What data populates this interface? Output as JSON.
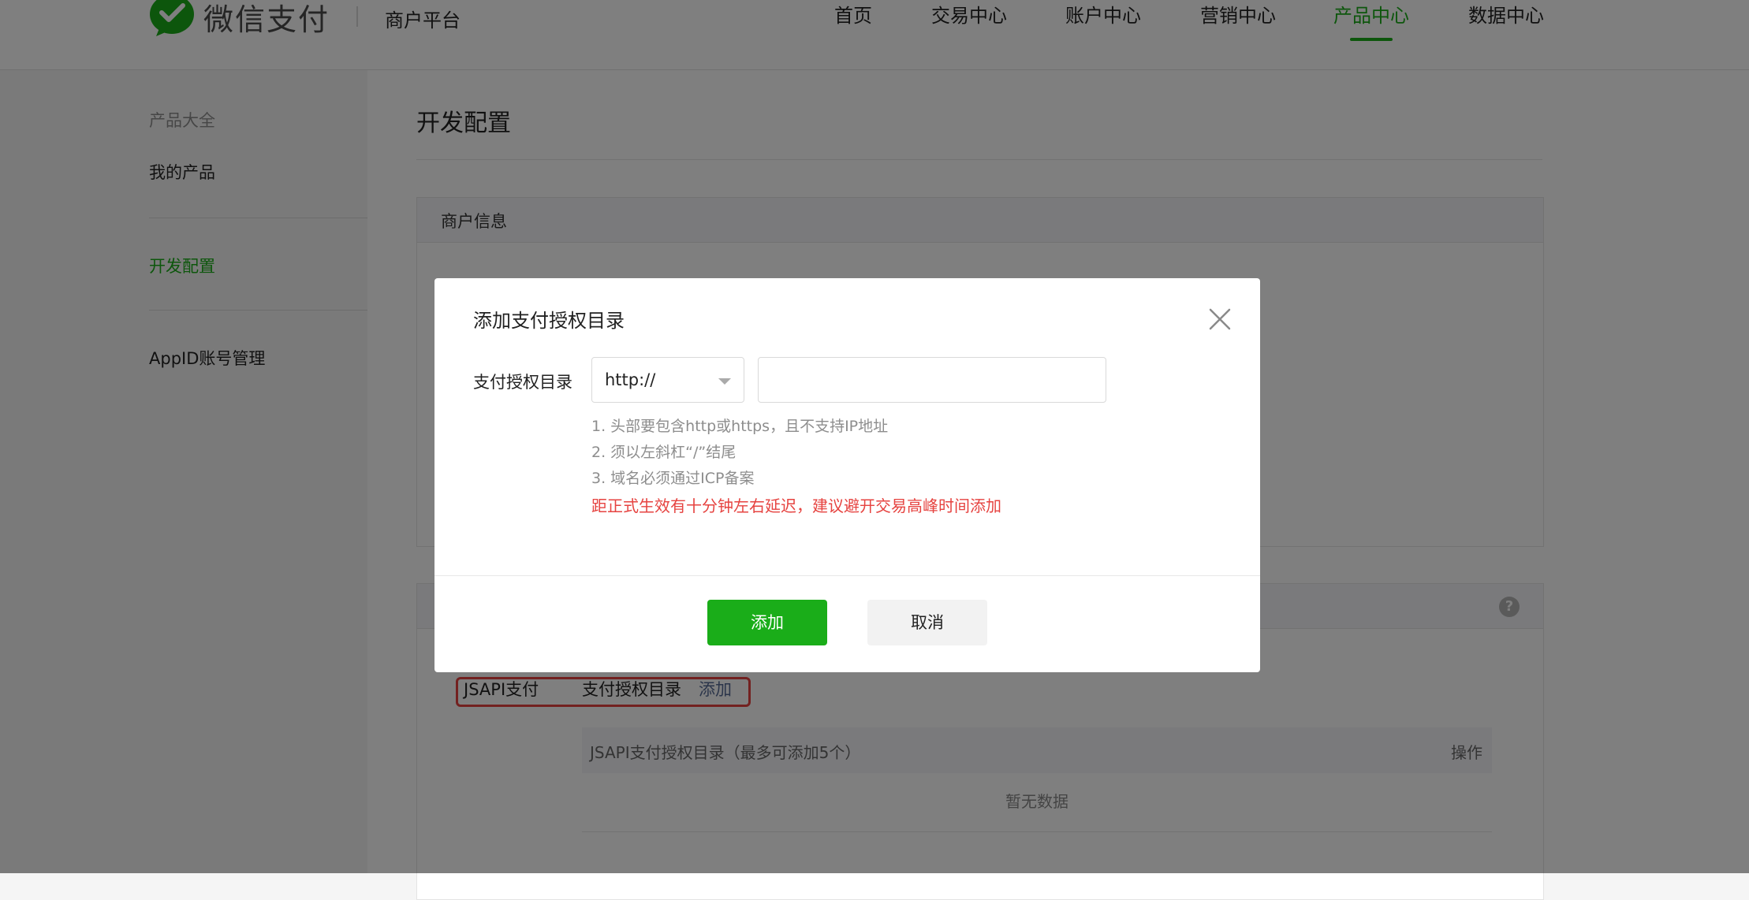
{
  "header": {
    "brand": "微信支付",
    "platform": "商户平台",
    "nav": [
      {
        "label": "首页",
        "active": false
      },
      {
        "label": "交易中心",
        "active": false
      },
      {
        "label": "账户中心",
        "active": false
      },
      {
        "label": "营销中心",
        "active": false
      },
      {
        "label": "产品中心",
        "active": true
      },
      {
        "label": "数据中心",
        "active": false
      }
    ]
  },
  "sidebar": {
    "items": [
      {
        "label": "产品大全"
      },
      {
        "label": "我的产品"
      },
      {
        "label": "开发配置"
      },
      {
        "label": "AppID账号管理"
      }
    ]
  },
  "main": {
    "title": "开发配置",
    "merchant_panel_title": "商户信息",
    "jsapi_label": "JSAPI支付",
    "jsapi_dir_label": "支付授权目录",
    "jsapi_add_link": "添加",
    "dir_table": {
      "col_dir": "JSAPI支付授权目录（最多可添加5个）",
      "col_op": "操作",
      "empty": "暂无数据"
    }
  },
  "modal": {
    "title": "添加支付授权目录",
    "field_label": "支付授权目录",
    "scheme_value": "http://",
    "url_value": "",
    "tips": [
      "1. 头部要包含http或https，且不支持IP地址",
      "2. 须以左斜杠“/”结尾",
      "3. 域名必须通过ICP备案"
    ],
    "warning": "距正式生效有十分钟左右延迟，建议避开交易高峰时间添加",
    "confirm_label": "添加",
    "cancel_label": "取消"
  },
  "colors": {
    "brand_green": "#1aad19",
    "warning_red": "#e64340",
    "link_blue": "#576b95"
  }
}
